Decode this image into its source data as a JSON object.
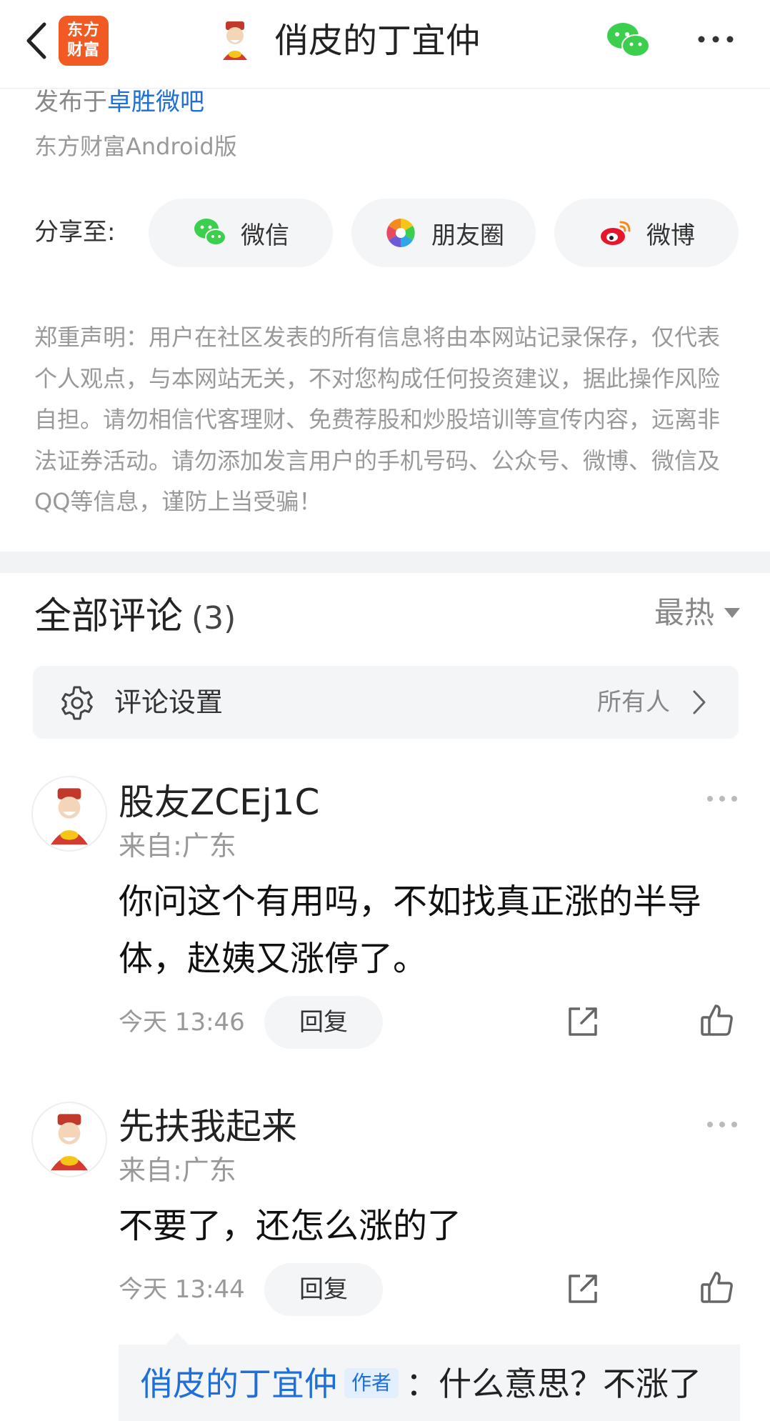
{
  "header": {
    "app_logo_line1": "东方",
    "app_logo_line2": "财富",
    "title": "俏皮的丁宜仲"
  },
  "post_meta": {
    "posted_in_prefix": "发布于",
    "forum_name": "卓胜微吧",
    "client": "东方财富Android版"
  },
  "share": {
    "label": "分享至:",
    "targets": [
      {
        "label": "微信",
        "icon": "wechat-icon"
      },
      {
        "label": "朋友圈",
        "icon": "moments-icon"
      },
      {
        "label": "微博",
        "icon": "weibo-icon"
      }
    ]
  },
  "disclaimer": "郑重声明：用户在社区发表的所有信息将由本网站记录保存，仅代表个人观点，与本网站无关，不对您构成任何投资建议，据此操作风险自担。请勿相信代客理财、免费荐股和炒股培训等宣传内容，远离非法证券活动。请勿添加发言用户的手机号码、公众号、微博、微信及QQ等信息，谨防上当受骗！",
  "comments_section": {
    "title": "全部评论",
    "count": "(3)",
    "sort_label": "最热",
    "settings_label": "评论设置",
    "settings_value": "所有人"
  },
  "comments": [
    {
      "name": "股友ZCEj1C",
      "location": "来自:广东",
      "text": "你问这个有用吗，不如找真正涨的半导体，赵姨又涨停了。",
      "time": "今天 13:46",
      "reply_label": "回复"
    },
    {
      "name": "先扶我起来",
      "location": "来自:广东",
      "text": "不要了，还怎么涨的了",
      "time": "今天 13:44",
      "reply_label": "回复",
      "sub_reply": {
        "author": "俏皮的丁宜仲",
        "badge": "作者",
        "text": "：什么意思？不涨了"
      }
    }
  ],
  "colors": {
    "link_blue": "#1e6fd9",
    "brand_orange": "#f15a22",
    "wechat_green": "#3ccf4e",
    "weibo_red": "#e6162d"
  }
}
